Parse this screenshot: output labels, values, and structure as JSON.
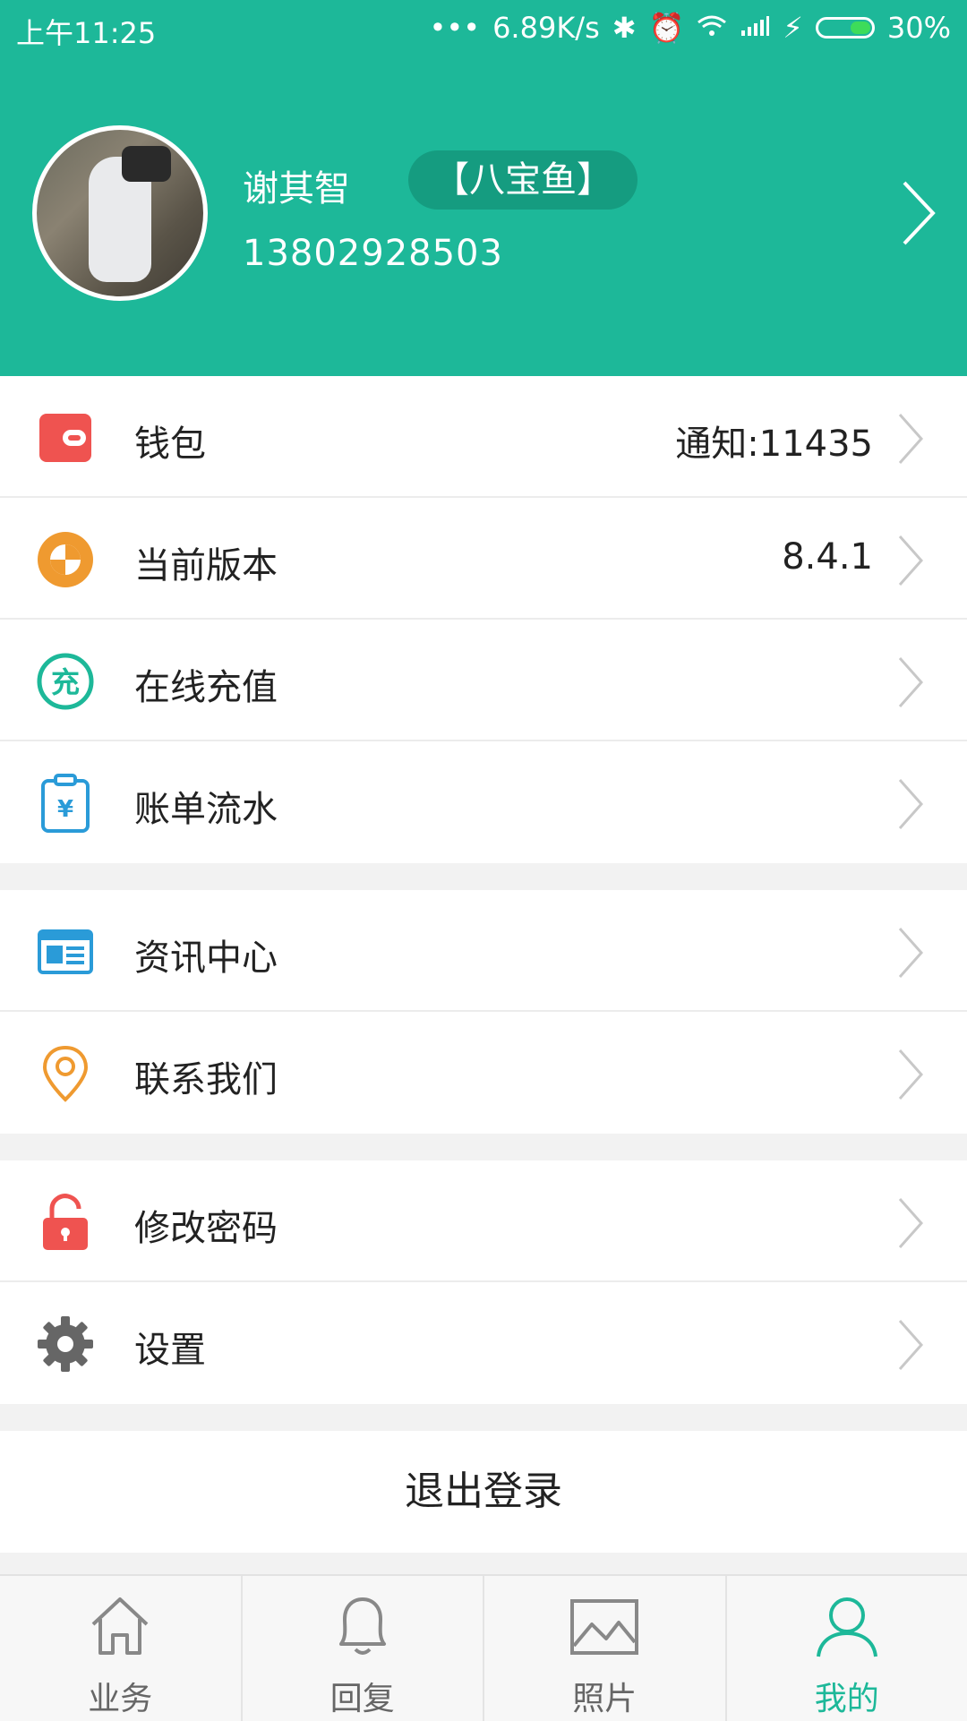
{
  "status_bar": {
    "time": "上午11:25",
    "dots": "•••",
    "speed": "6.89K/s",
    "battery": "30%",
    "battery_level": 0.3
  },
  "profile": {
    "name": "谢其智",
    "tag": "【八宝鱼】",
    "phone": "13802928503"
  },
  "menu_groups": [
    {
      "items": [
        {
          "label": "钱包",
          "value": "通知:11435",
          "icon": "wallet-icon",
          "color": "#ef5350"
        },
        {
          "label": "当前版本",
          "value": "8.4.1",
          "icon": "version-icon",
          "color": "#ef9a30"
        },
        {
          "label": "在线充值",
          "value": "",
          "icon": "recharge-icon",
          "color": "#1db899"
        },
        {
          "label": "账单流水",
          "value": "",
          "icon": "bill-icon",
          "color": "#2a9bd8"
        }
      ]
    },
    {
      "items": [
        {
          "label": "资讯中心",
          "value": "",
          "icon": "news-icon",
          "color": "#2a9bd8"
        },
        {
          "label": "联系我们",
          "value": "",
          "icon": "location-icon",
          "color": "#ef9a30"
        }
      ]
    },
    {
      "items": [
        {
          "label": "修改密码",
          "value": "",
          "icon": "lock-icon",
          "color": "#ef5350"
        },
        {
          "label": "设置",
          "value": "",
          "icon": "gear-icon",
          "color": "#666666"
        }
      ]
    }
  ],
  "logout_label": "退出登录",
  "tabs": [
    {
      "label": "业务",
      "icon": "home-icon",
      "active": false
    },
    {
      "label": "回复",
      "icon": "bell-icon",
      "active": false
    },
    {
      "label": "照片",
      "icon": "image-icon",
      "active": false
    },
    {
      "label": "我的",
      "icon": "user-icon",
      "active": true
    }
  ],
  "colors": {
    "header_bg": "#1db899",
    "tag_bg": "#159c80",
    "accent": "#1db899"
  }
}
